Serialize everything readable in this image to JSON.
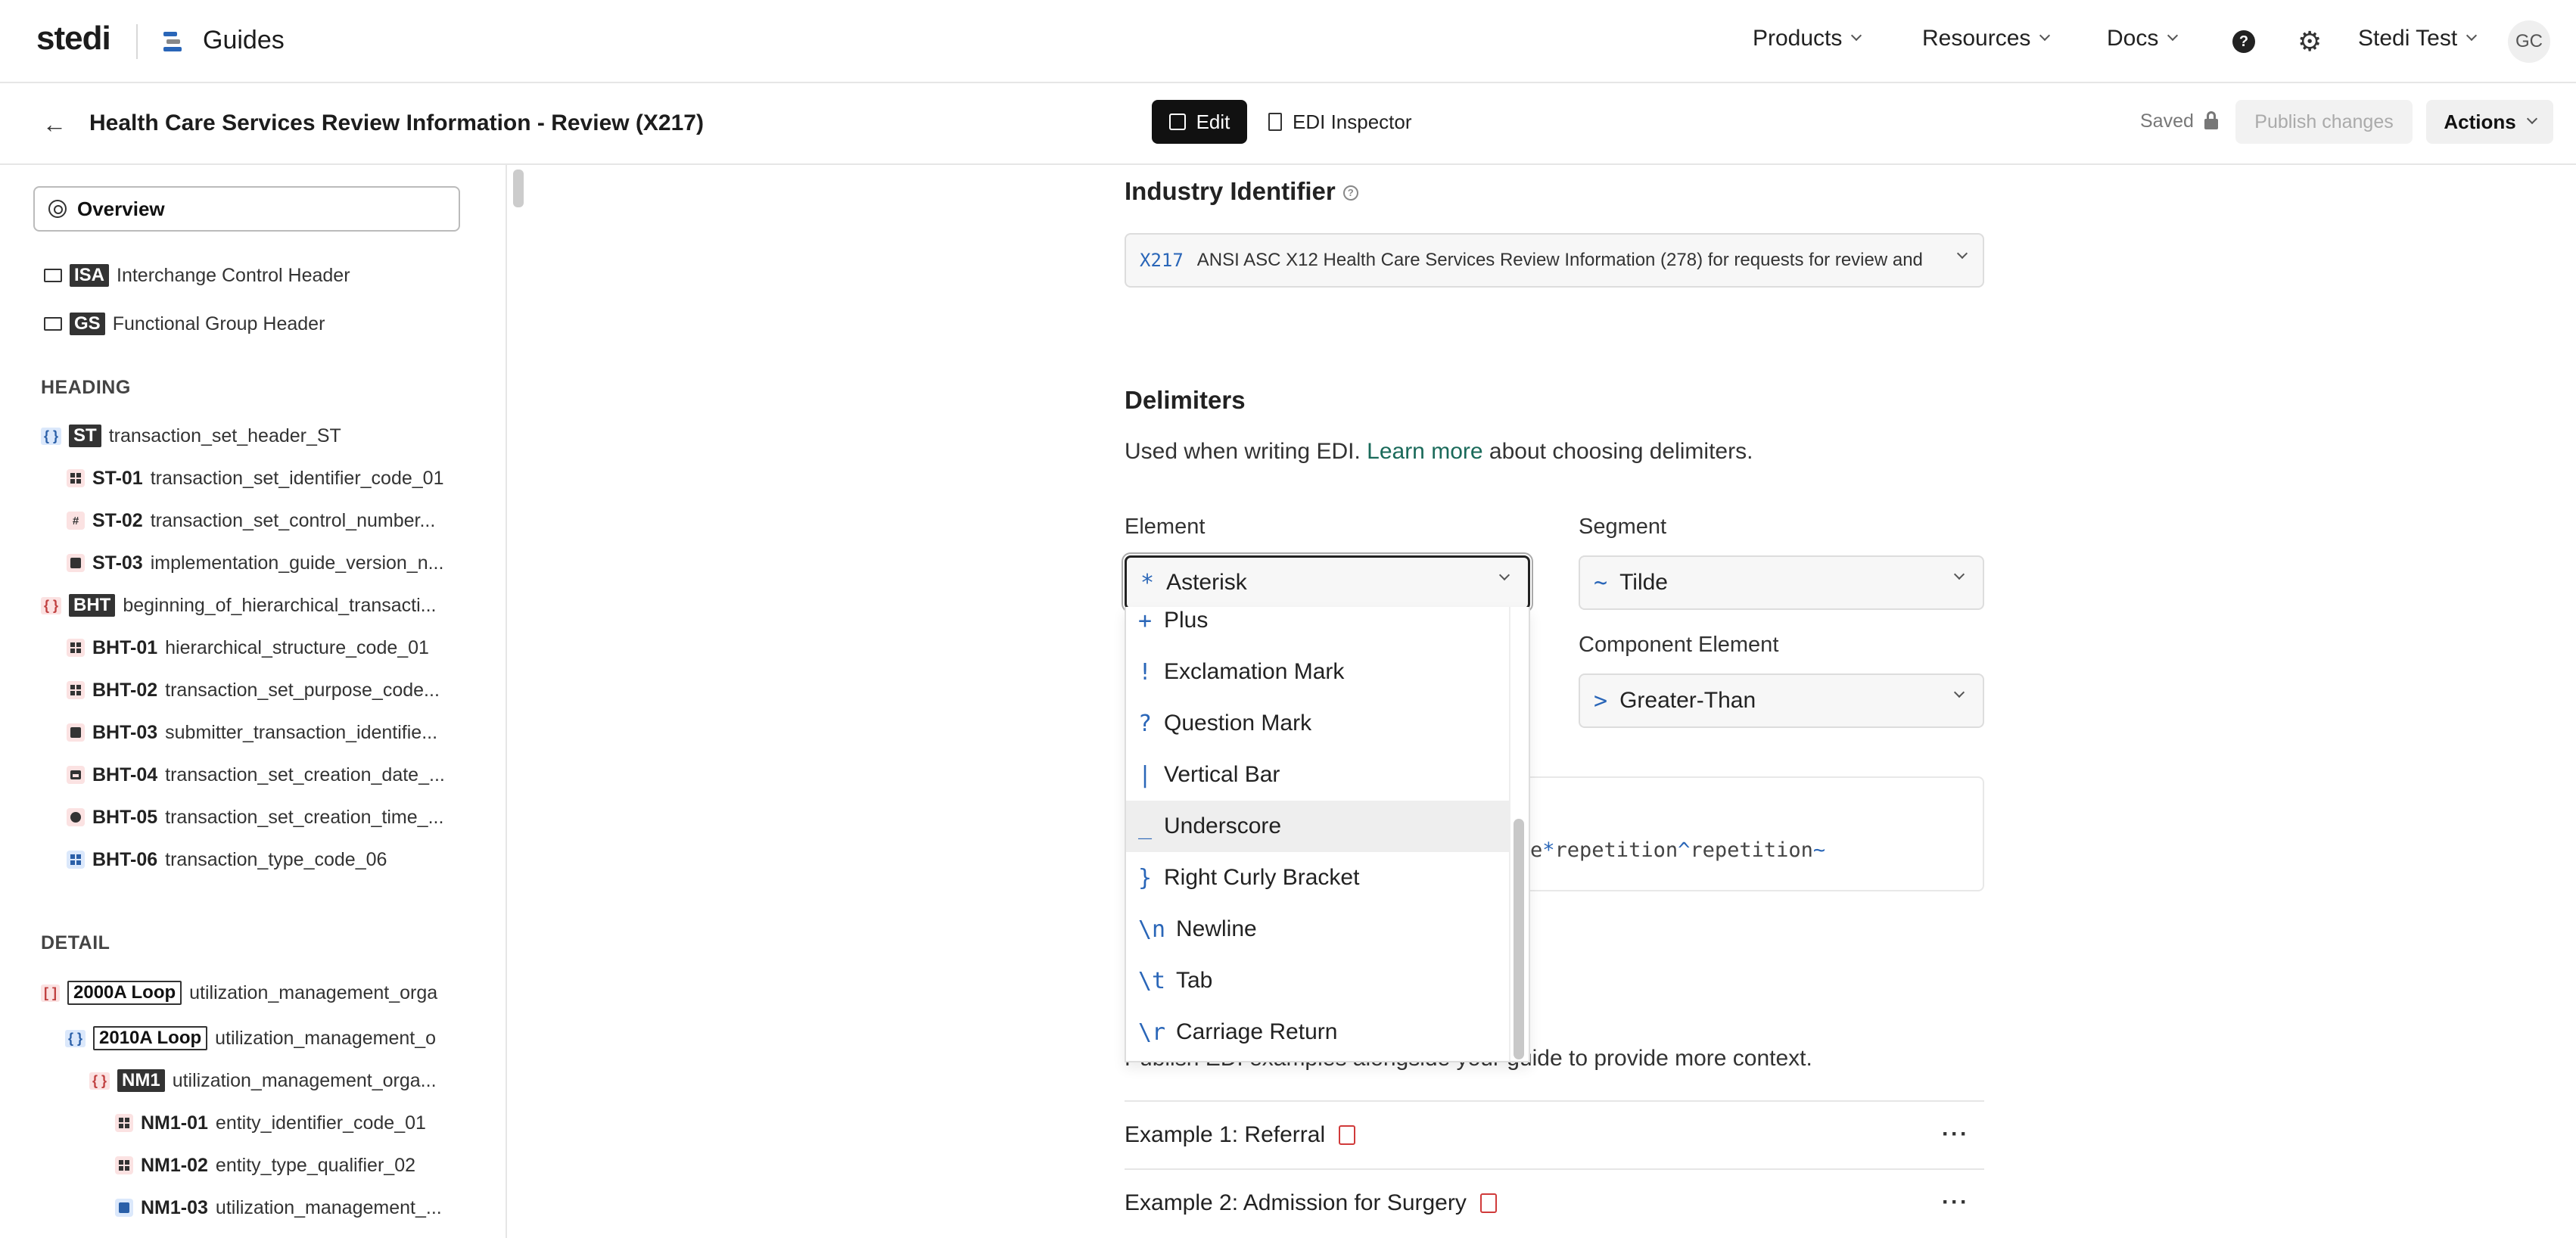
{
  "nav": {
    "logo": "stedi",
    "app": "Guides",
    "items": [
      "Products",
      "Resources",
      "Docs"
    ],
    "user": "Stedi Test",
    "avatar": "GC"
  },
  "toolbar": {
    "title": "Health Care Services Review Information - Review (X217)",
    "edit": "Edit",
    "inspector": "EDI Inspector",
    "saved": "Saved",
    "publish": "Publish changes",
    "actions": "Actions"
  },
  "sidebar": {
    "overview": "Overview",
    "isa": {
      "code": "ISA",
      "label": "Interchange Control Header"
    },
    "gs": {
      "code": "GS",
      "label": "Functional Group Header"
    },
    "heading_title": "HEADING",
    "st": {
      "code": "ST",
      "label": "transaction_set_header_ST"
    },
    "st_items": [
      {
        "code": "ST-01",
        "label": "transaction_set_identifier_code_01"
      },
      {
        "code": "ST-02",
        "label": "transaction_set_control_number..."
      },
      {
        "code": "ST-03",
        "label": "implementation_guide_version_n..."
      }
    ],
    "bht": {
      "code": "BHT",
      "label": "beginning_of_hierarchical_transacti..."
    },
    "bht_items": [
      {
        "code": "BHT-01",
        "label": "hierarchical_structure_code_01"
      },
      {
        "code": "BHT-02",
        "label": "transaction_set_purpose_code..."
      },
      {
        "code": "BHT-03",
        "label": "submitter_transaction_identifie..."
      },
      {
        "code": "BHT-04",
        "label": "transaction_set_creation_date_..."
      },
      {
        "code": "BHT-05",
        "label": "transaction_set_creation_time_..."
      },
      {
        "code": "BHT-06",
        "label": "transaction_type_code_06"
      }
    ],
    "detail_title": "DETAIL",
    "loop2000a": {
      "code": "2000A Loop",
      "label": "utilization_management_orga"
    },
    "loop2010a": {
      "code": "2010A Loop",
      "label": "utilization_management_o"
    },
    "nm1": {
      "code": "NM1",
      "label": "utilization_management_orga..."
    },
    "nm1_items": [
      {
        "code": "NM1-01",
        "label": "entity_identifier_code_01"
      },
      {
        "code": "NM1-02",
        "label": "entity_type_qualifier_02"
      },
      {
        "code": "NM1-03",
        "label": "utilization_management_..."
      }
    ]
  },
  "main": {
    "industry_title": "Industry Identifier",
    "industry_code": "X217",
    "industry_text": "ANSI ASC X12 Health Care Services Review Information (278) for requests for review and",
    "delimiters_title": "Delimiters",
    "delim_desc_pre": "Used when writing EDI.",
    "delim_desc_link": "Learn more",
    "delim_desc_post": "about choosing delimiters.",
    "element_label": "Element",
    "element_symbol": "*",
    "element_value": "Asterisk",
    "segment_label": "Segment",
    "segment_symbol": "~",
    "segment_value": "Tilde",
    "component_label": "Component Element",
    "component_symbol": ">",
    "component_value": "Greater-Than",
    "preview_a": "e",
    "preview_b": "*",
    "preview_c": "repetition",
    "preview_d": "^",
    "preview_e": "repetition",
    "preview_f": "~",
    "examples_desc": "Publish EDI examples alongside your guide to provide more context.",
    "examples": [
      {
        "label": "Example 1: Referral"
      },
      {
        "label": "Example 2: Admission for Surgery"
      }
    ]
  },
  "dropdown": {
    "items": [
      {
        "symbol": "+",
        "label": "Plus"
      },
      {
        "symbol": "!",
        "label": "Exclamation Mark"
      },
      {
        "symbol": "?",
        "label": "Question Mark"
      },
      {
        "symbol": "|",
        "label": "Vertical Bar"
      },
      {
        "symbol": "_",
        "label": "Underscore"
      },
      {
        "symbol": "}",
        "label": "Right Curly Bracket"
      },
      {
        "symbol": "\\n",
        "label": "Newline"
      },
      {
        "symbol": "\\t",
        "label": "Tab"
      },
      {
        "symbol": "\\r",
        "label": "Carriage Return"
      }
    ],
    "highlighted_index": 4
  }
}
